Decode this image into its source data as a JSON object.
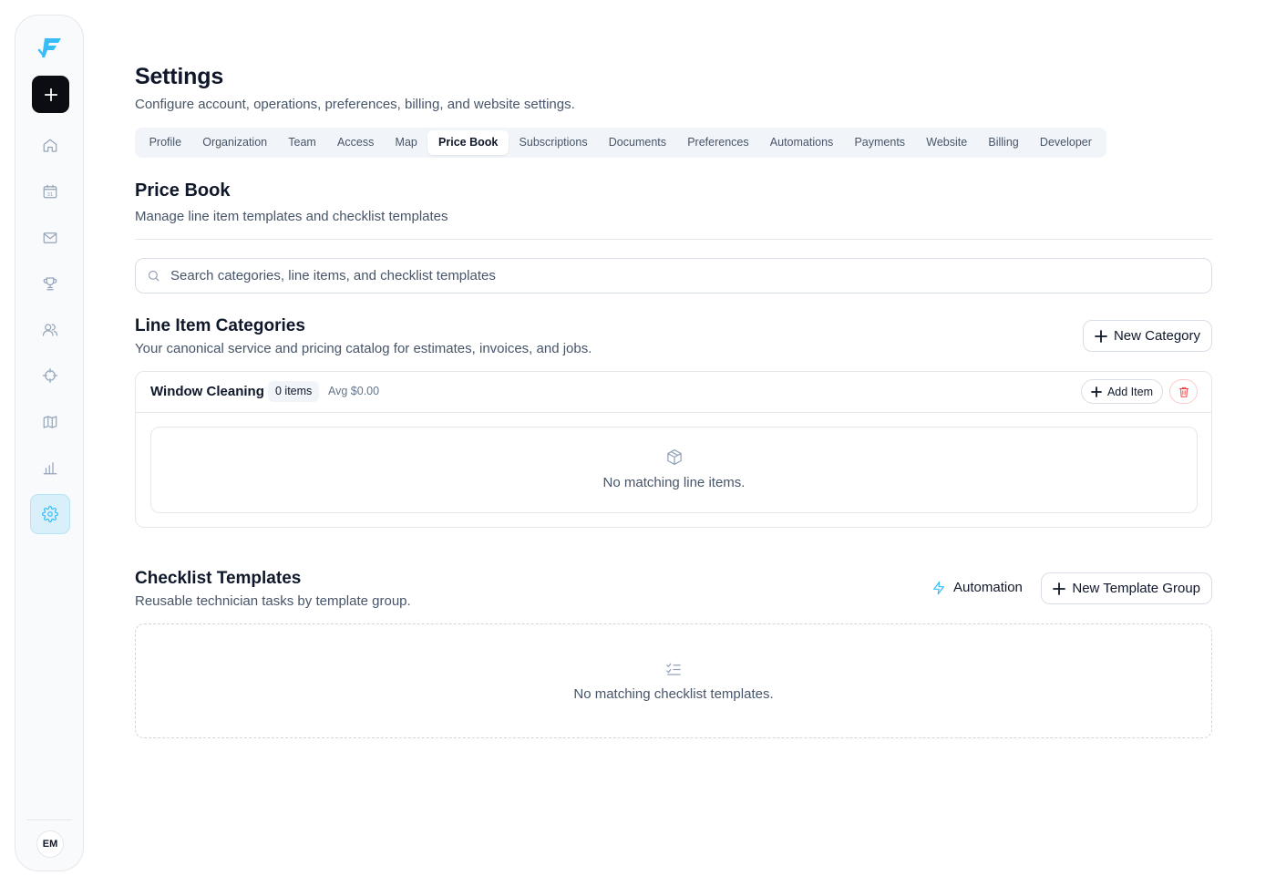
{
  "sidebar": {
    "icons": [
      "app-logo-icon",
      "plus-icon",
      "home-icon",
      "calendar-icon",
      "mail-icon",
      "trophy-icon",
      "users-icon",
      "crosshair-icon",
      "map-icon",
      "chart-icon",
      "gear-icon"
    ],
    "active": "settings",
    "calendar_day": "31",
    "avatar_initials": "EM"
  },
  "header": {
    "title": "Settings",
    "subtitle": "Configure account, operations, preferences, billing, and website settings."
  },
  "tabs": [
    {
      "label": "Profile"
    },
    {
      "label": "Organization"
    },
    {
      "label": "Team"
    },
    {
      "label": "Access"
    },
    {
      "label": "Map"
    },
    {
      "label": "Price Book",
      "active": true
    },
    {
      "label": "Subscriptions"
    },
    {
      "label": "Documents"
    },
    {
      "label": "Preferences"
    },
    {
      "label": "Automations"
    },
    {
      "label": "Payments"
    },
    {
      "label": "Website"
    },
    {
      "label": "Billing"
    },
    {
      "label": "Developer"
    }
  ],
  "price_book": {
    "title": "Price Book",
    "subtitle": "Manage line item templates and checklist templates",
    "search_placeholder": "Search categories, line items, and checklist templates"
  },
  "line_items": {
    "title": "Line Item Categories",
    "subtitle": "Your canonical service and pricing catalog for estimates, invoices, and jobs.",
    "new_category_label": "New Category",
    "categories": [
      {
        "name": "Window Cleaning",
        "count": "0 items",
        "avg": "Avg $0.00",
        "add_item_label": "Add Item",
        "empty_text": "No matching line items."
      }
    ]
  },
  "checklists": {
    "title": "Checklist Templates",
    "subtitle": "Reusable technician tasks by template group.",
    "automation_label": "Automation",
    "new_group_label": "New Template Group",
    "empty_text": "No matching checklist templates."
  },
  "colors": {
    "accent": "#38bdf8",
    "danger": "#ef4444",
    "primary_button": "#0b0d12"
  }
}
